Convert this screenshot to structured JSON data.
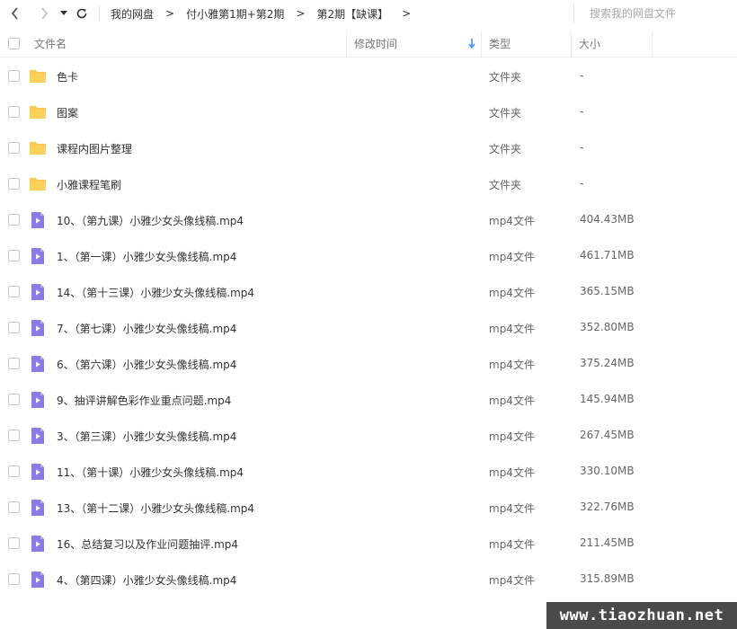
{
  "nav": {
    "back_icon": "chevron-left-icon",
    "forward_icon": "chevron-right-icon",
    "dropdown_icon": "caret-down-icon",
    "refresh_icon": "refresh-icon"
  },
  "breadcrumbs": [
    {
      "label": "我的网盘"
    },
    {
      "label": "付小雅第1期+第2期"
    },
    {
      "label": "第2期【缺课】"
    }
  ],
  "search": {
    "placeholder": "搜索我的网盘文件"
  },
  "columns": {
    "name": "文件名",
    "modified": "修改时间",
    "type": "类型",
    "size": "大小"
  },
  "colors": {
    "folder": "#f9c74f",
    "video": "#8c7ae6",
    "sort_arrow": "#3b8cff"
  },
  "files": [
    {
      "name": "色卡",
      "type": "文件夹",
      "size": "-",
      "icon": "folder-icon"
    },
    {
      "name": "图案",
      "type": "文件夹",
      "size": "-",
      "icon": "folder-icon"
    },
    {
      "name": "课程内图片整理",
      "type": "文件夹",
      "size": "-",
      "icon": "folder-icon"
    },
    {
      "name": "小雅课程笔刷",
      "type": "文件夹",
      "size": "-",
      "icon": "folder-icon"
    },
    {
      "name": "10、（第九课）小雅少女头像线稿.mp4",
      "type": "mp4文件",
      "size": "404.43MB",
      "icon": "video-file-icon"
    },
    {
      "name": "1、（第一课）小雅少女头像线稿.mp4",
      "type": "mp4文件",
      "size": "461.71MB",
      "icon": "video-file-icon"
    },
    {
      "name": "14、（第十三课）小雅少女头像线稿.mp4",
      "type": "mp4文件",
      "size": "365.15MB",
      "icon": "video-file-icon"
    },
    {
      "name": "7、（第七课）小雅少女头像线稿.mp4",
      "type": "mp4文件",
      "size": "352.80MB",
      "icon": "video-file-icon"
    },
    {
      "name": "6、（第六课）小雅少女头像线稿.mp4",
      "type": "mp4文件",
      "size": "375.24MB",
      "icon": "video-file-icon"
    },
    {
      "name": "9、抽评讲解色彩作业重点问题.mp4",
      "type": "mp4文件",
      "size": "145.94MB",
      "icon": "video-file-icon"
    },
    {
      "name": "3、（第三课）小雅少女头像线稿.mp4",
      "type": "mp4文件",
      "size": "267.45MB",
      "icon": "video-file-icon"
    },
    {
      "name": "11、（第十课）小雅少女头像线稿.mp4",
      "type": "mp4文件",
      "size": "330.10MB",
      "icon": "video-file-icon"
    },
    {
      "name": "13、（第十二课）小雅少女头像线稿.mp4",
      "type": "mp4文件",
      "size": "322.76MB",
      "icon": "video-file-icon"
    },
    {
      "name": "16、总结复习以及作业问题抽评.mp4",
      "type": "mp4文件",
      "size": "211.45MB",
      "icon": "video-file-icon"
    },
    {
      "name": "4、（第四课）小雅少女头像线稿.mp4",
      "type": "mp4文件",
      "size": "315.89MB",
      "icon": "video-file-icon"
    }
  ],
  "watermark": "www.tiaozhuan.net"
}
